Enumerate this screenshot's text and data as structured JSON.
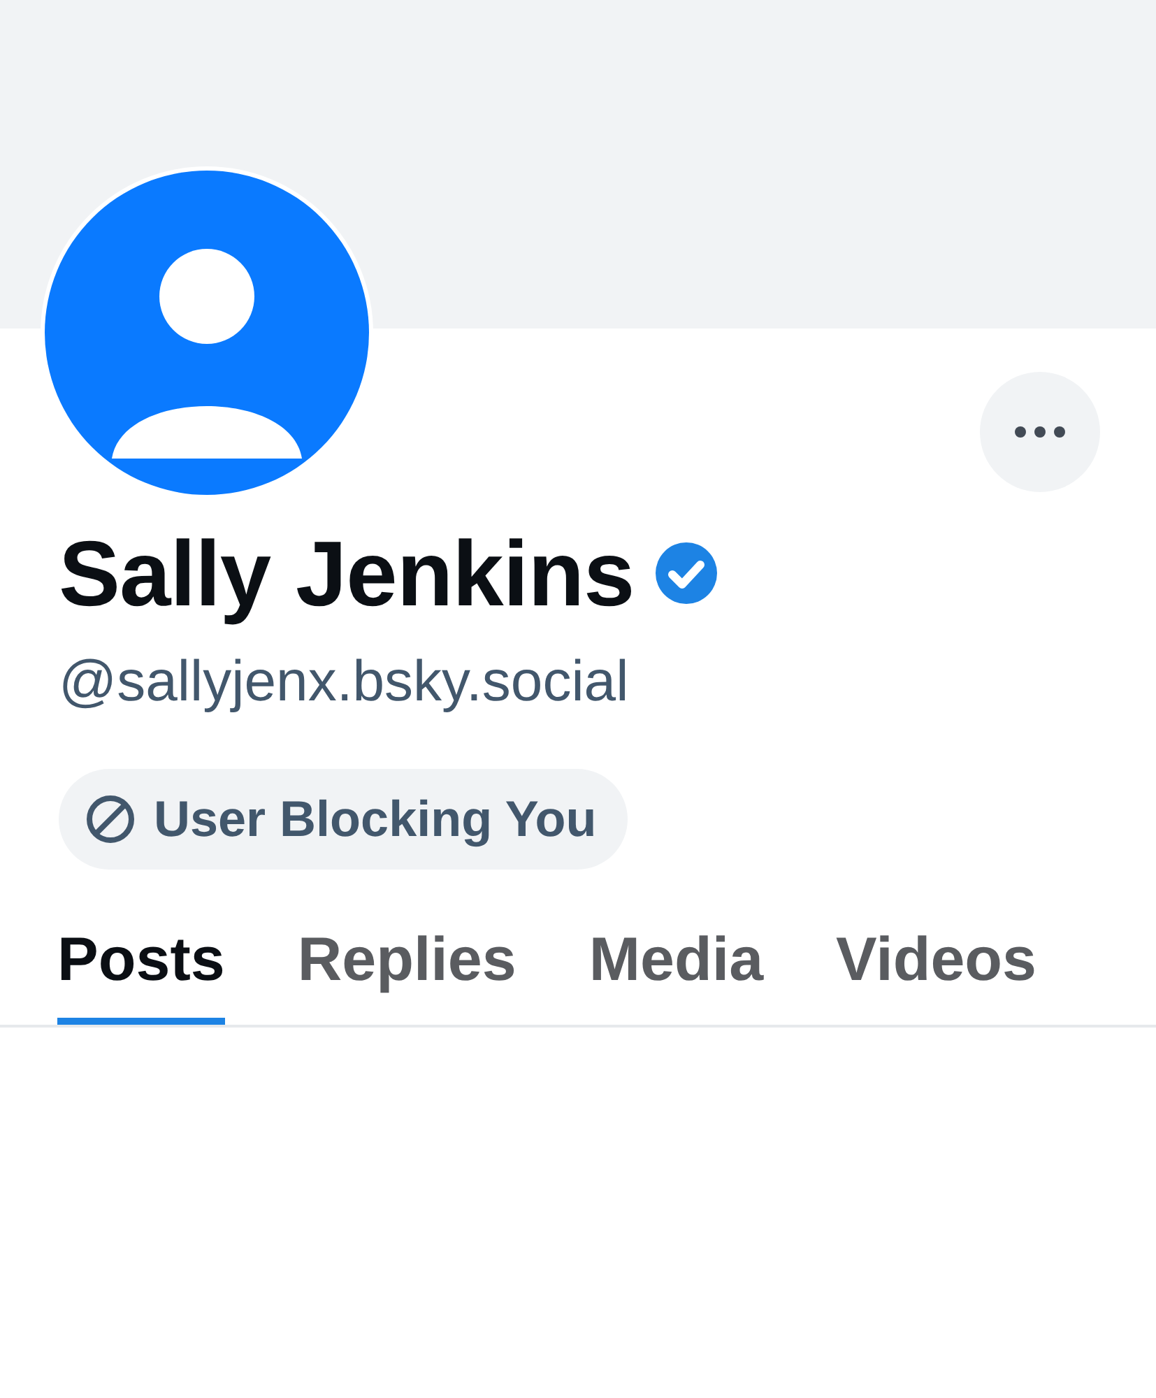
{
  "profile": {
    "name": "Sally Jenkins",
    "verified": true,
    "handle": "@sallyjenx.bsky.social"
  },
  "badge": {
    "label": "User Blocking You"
  },
  "tabs": [
    {
      "label": "Posts",
      "selected": true
    },
    {
      "label": "Replies",
      "selected": false
    },
    {
      "label": "Media",
      "selected": false
    },
    {
      "label": "Videos",
      "selected": false
    }
  ]
}
